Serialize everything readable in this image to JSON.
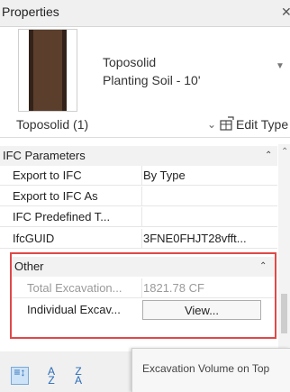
{
  "panel": {
    "title": "Properties",
    "close_icon": "close-icon"
  },
  "type_selector": {
    "name": "Toposolid",
    "subtype": "Planting Soil - 10'",
    "swatch_color": "#5b3e2b"
  },
  "instance_selector": {
    "label": "Toposolid (1)",
    "edit_type_label": "Edit Type"
  },
  "groups": {
    "ifc": {
      "title": "IFC Parameters",
      "rows": [
        {
          "name": "Export to IFC",
          "value": "By Type"
        },
        {
          "name": "Export to IFC As",
          "value": ""
        },
        {
          "name": "IFC Predefined T...",
          "value": ""
        },
        {
          "name": "IfcGUID",
          "value": "3FNE0FHJT28vfft..."
        }
      ]
    },
    "other": {
      "title": "Other",
      "rows": [
        {
          "name": "Total Excavation...",
          "value": "1821.78 CF"
        },
        {
          "name": "Individual Excav...",
          "value": "View..."
        }
      ]
    }
  },
  "tooltip": {
    "text": "Excavation Volume on Top"
  },
  "highlight_color": "#e04848"
}
